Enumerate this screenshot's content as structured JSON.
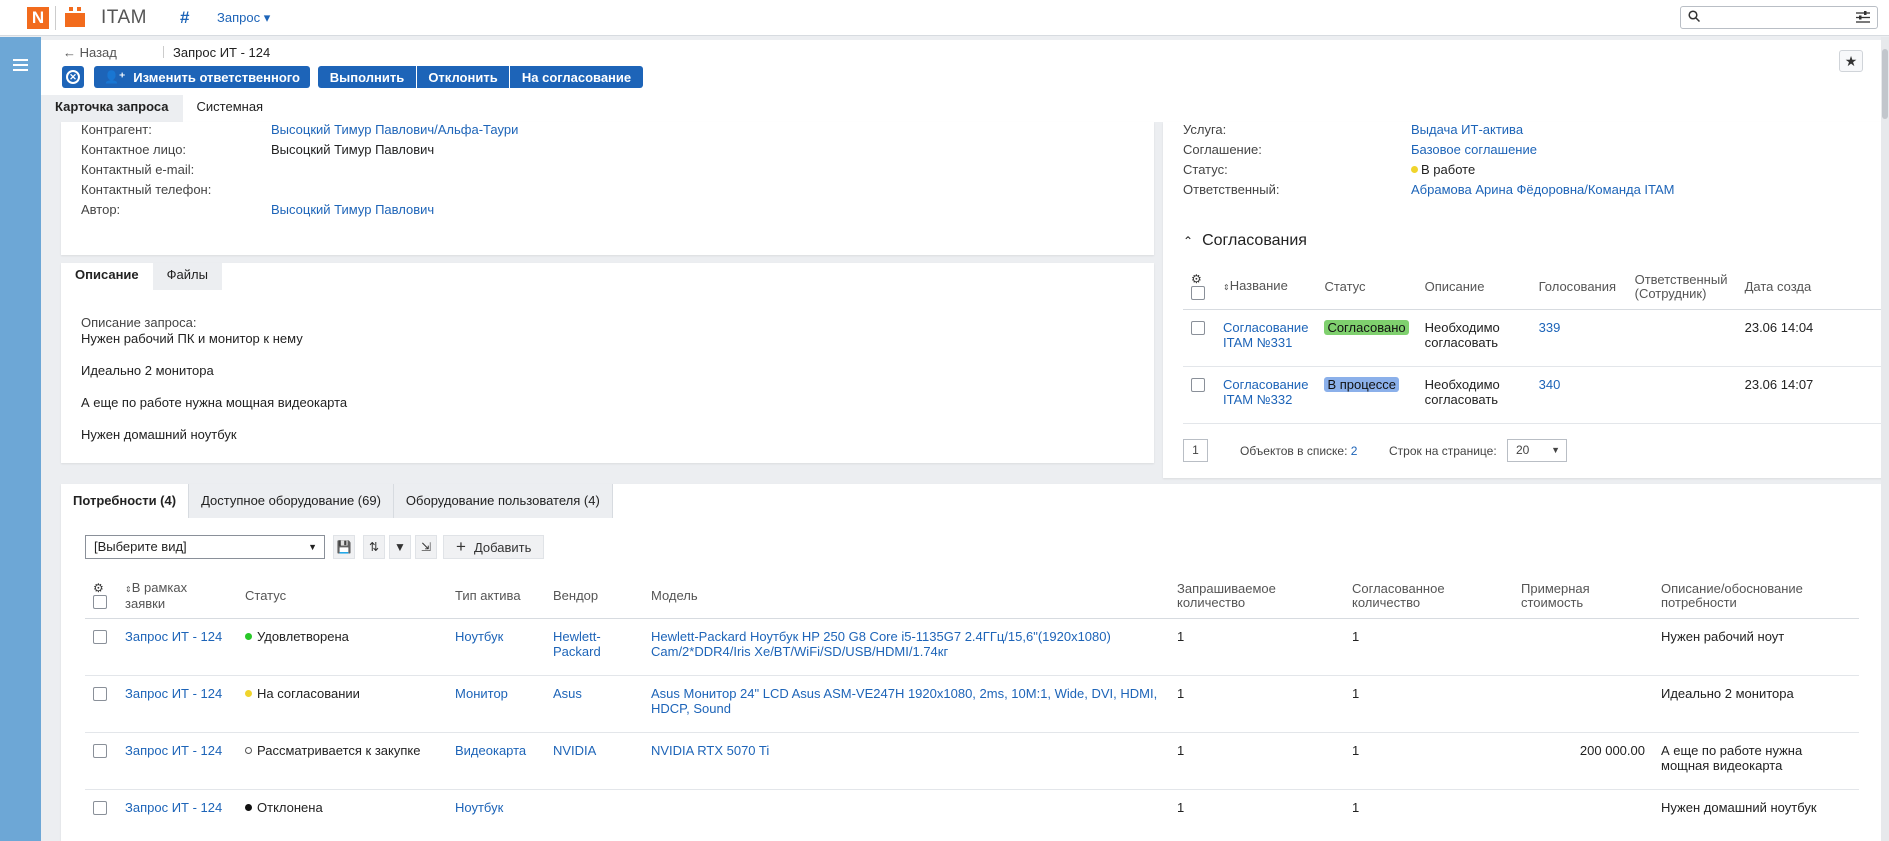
{
  "app": {
    "logo_letter": "N",
    "name": "ITAM",
    "module_menu": "Запрос ▾"
  },
  "colors": {
    "brand_orange": "#f26b1d",
    "primary_blue": "#1d64b8",
    "sidebar_blue": "#6da7d6",
    "status_green": "#28c828",
    "status_yellow": "#f0d42c",
    "badge_green": "#7fd06e",
    "badge_blue": "#8bb0ea"
  },
  "header": {
    "back_label": "← Назад",
    "title": "Запрос ИТ - 124",
    "buttons": {
      "change_responsible": "Изменить ответственного",
      "execute": "Выполнить",
      "reject": "Отклонить",
      "to_approval": "На согласование"
    },
    "tabs": [
      "Карточка запроса",
      "Системная"
    ]
  },
  "left_fields": [
    {
      "label": "Контрагент:",
      "value": "Высоцкий Тимур Павлович/Альфа-Таури",
      "link": true
    },
    {
      "label": "Контактное лицо:",
      "value": "Высоцкий Тимур Павлович",
      "link": false
    },
    {
      "label": "Контактный e-mail:",
      "value": "",
      "link": false
    },
    {
      "label": "Контактный телефон:",
      "value": "",
      "link": false
    },
    {
      "label": "Автор:",
      "value": "Высоцкий Тимур Павлович",
      "link": true
    }
  ],
  "right_fields": [
    {
      "label": "Услуга:",
      "value": "Выдача ИТ-актива"
    },
    {
      "label": "Соглашение:",
      "value": "Базовое соглашение"
    },
    {
      "label": "Статус:",
      "value": "В работе"
    },
    {
      "label": "Ответственный:",
      "value": "Абрамова Арина Фёдоровна/Команда ITAM"
    }
  ],
  "description": {
    "tabs": [
      "Описание",
      "Файлы"
    ],
    "label": "Описание запроса:",
    "lines": [
      "Нужен рабочий ПК и монитор к нему",
      "Идеально 2 монитора",
      "А еще по работе нужна мощная видеокарта",
      "Нужен домашний ноутбук"
    ]
  },
  "approvals": {
    "title": "Согласования",
    "columns": [
      "Название",
      "Статус",
      "Описание",
      "Голосования",
      "Ответственный (Сотрудник)",
      "Дата созда"
    ],
    "rows": [
      {
        "name": "Согласование ITAM №331",
        "status": "Согласовано",
        "desc": "Необходимо согласовать",
        "votes": "339",
        "date": "23.06 14:04"
      },
      {
        "name": "Согласование ITAM №332",
        "status": "В процессе",
        "desc": "Необходимо согласовать",
        "votes": "340",
        "date": "23.06 14:07"
      }
    ],
    "pager": {
      "page": "1",
      "count_label": "Объектов в списке:",
      "count": "2",
      "rows_label": "Строк на странице:",
      "rows": "20"
    }
  },
  "bottom": {
    "tabs": [
      "Потребности (4)",
      "Доступное оборудование (69)",
      "Оборудование пользователя (4)"
    ],
    "view_select": "[Выберите вид]",
    "add_label": "Добавить",
    "columns": [
      "В рамках заявки",
      "Статус",
      "Тип актива",
      "Вендор",
      "Модель",
      "Запрашиваемое количество",
      "Согласованное количество",
      "Примерная стоимость",
      "Описание/обоснование потребности"
    ],
    "rows": [
      {
        "request": "Запрос ИТ - 124",
        "status": "Удовлетворена",
        "status_color": "#28c828",
        "type": "Ноутбук",
        "vendor": "Hewlett-Packard",
        "model": "Hewlett-Packard Ноутбук HP 250 G8 Core i5-1135G7 2.4ГГц/15,6\"(1920x1080) Cam/2*DDR4/Iris Xe/BT/WiFi/SD/USB/HDMI/1.74кг",
        "req_qty": "1",
        "appr_qty": "1",
        "cost": "",
        "note": "Нужен рабочий ноут"
      },
      {
        "request": "Запрос ИТ - 124",
        "status": "На согласовании",
        "status_color": "#f0d42c",
        "type": "Монитор",
        "vendor": "Asus",
        "model": "Asus Монитор 24\" LCD Asus ASM-VE247H 1920x1080, 2ms, 10M:1, Wide, DVI, HDMI, HDCP, Sound",
        "req_qty": "1",
        "appr_qty": "1",
        "cost": "",
        "note": "Идеально 2 монитора"
      },
      {
        "request": "Запрос ИТ - 124",
        "status": "Рассматривается к закупке",
        "status_color": "hollow",
        "type": "Видеокарта",
        "vendor": "NVIDIA",
        "model": "NVIDIA RTX 5070 Ti",
        "req_qty": "1",
        "appr_qty": "1",
        "cost": "200 000.00",
        "note": "А еще по работе нужна мощная видеокарта"
      },
      {
        "request": "Запрос ИТ - 124",
        "status": "Отклонена",
        "status_color": "#111111",
        "type": "Ноутбук",
        "vendor": "",
        "model": "",
        "req_qty": "1",
        "appr_qty": "1",
        "cost": "",
        "note": "Нужен домашний ноутбук"
      }
    ]
  }
}
